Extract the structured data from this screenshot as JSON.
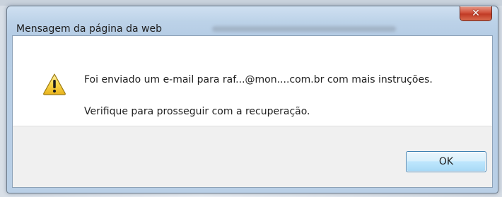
{
  "dialog": {
    "title": "Mensagem da página da web",
    "close_icon": "close-icon",
    "icon": "warning-icon",
    "message_line_1": "Foi enviado um e-mail para raf...@mon....com.br com mais instruções.",
    "message_line_2": "Verifique para prosseguir com a recuperação.",
    "ok_label": "OK"
  },
  "colors": {
    "close_button": "#c94a33",
    "ok_border": "#3c7fb1",
    "warning_fill": "#f7d54a"
  }
}
